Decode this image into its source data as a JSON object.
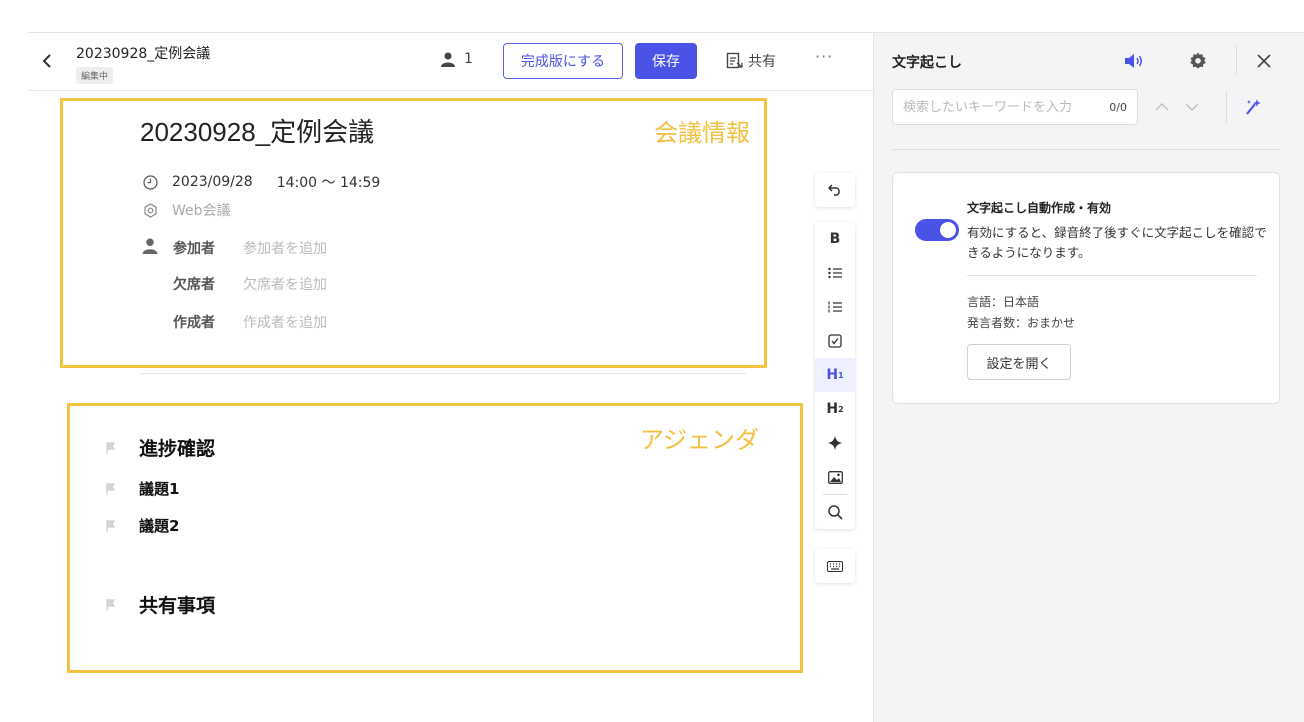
{
  "header": {
    "title": "20230928_定例会議",
    "status": "編集中",
    "user_count": "1",
    "finalize_label": "完成版にする",
    "save_label": "保存",
    "share_label": "共有",
    "more_label": "···"
  },
  "meeting": {
    "title": "20230928_定例会議",
    "date": "2023/09/28",
    "time": "14:00 〜 14:59",
    "location": "Web会議",
    "people": [
      {
        "label": "参加者",
        "placeholder": "参加者を追加"
      },
      {
        "label": "欠席者",
        "placeholder": "欠席者を追加"
      },
      {
        "label": "作成者",
        "placeholder": "作成者を追加"
      }
    ]
  },
  "agenda": {
    "items": [
      "進捗確認",
      "議題1",
      "議題2",
      "共有事項"
    ]
  },
  "annotations": {
    "meeting_info": "会議情報",
    "agenda": "アジェンダ",
    "color": "#f2c442"
  },
  "toolbar": {
    "bold": "B",
    "h1": "H",
    "h1_sub": "1",
    "h2": "H",
    "h2_sub": "2",
    "active": "h1"
  },
  "transcript_panel": {
    "title": "文字起こし",
    "search_placeholder": "検索したいキーワードを入力",
    "search_count": "0/0",
    "card": {
      "title": "文字起こし自動作成・有効",
      "description": "有効にすると、録音終了後すぐに文字起こしを確認できるようになります。",
      "language": "言語：日本語",
      "speakers": "発言者数：おまかせ",
      "button": "設定を開く",
      "toggle_on": true
    }
  },
  "colors": {
    "accent": "#4b53e6",
    "annotation": "#f2c442",
    "panel_bg": "#f4f4f6"
  }
}
